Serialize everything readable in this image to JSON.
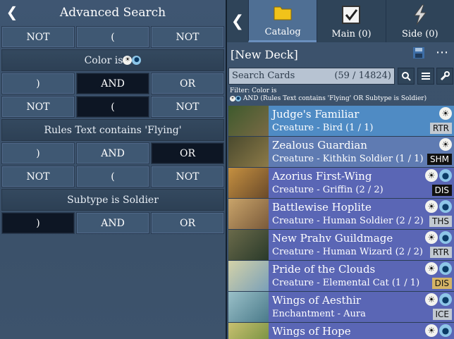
{
  "left": {
    "title": "Advanced Search",
    "rows": [
      {
        "cells": [
          {
            "label": "NOT",
            "sel": false
          },
          {
            "label": "(",
            "sel": false
          },
          {
            "label": "NOT",
            "sel": false
          }
        ]
      },
      {
        "label": "Color is",
        "mana": [
          "W",
          "U"
        ]
      },
      {
        "cells": [
          {
            "label": ")",
            "sel": false
          },
          {
            "label": "AND",
            "sel": true
          },
          {
            "label": "OR",
            "sel": false
          }
        ]
      },
      {
        "cells": [
          {
            "label": "NOT",
            "sel": false
          },
          {
            "label": "(",
            "sel": true
          },
          {
            "label": "NOT",
            "sel": false
          }
        ]
      },
      {
        "label": "Rules Text contains 'Flying'"
      },
      {
        "cells": [
          {
            "label": ")",
            "sel": false
          },
          {
            "label": "AND",
            "sel": false
          },
          {
            "label": "OR",
            "sel": true
          }
        ]
      },
      {
        "cells": [
          {
            "label": "NOT",
            "sel": false
          },
          {
            "label": "(",
            "sel": false
          },
          {
            "label": "NOT",
            "sel": false
          }
        ]
      },
      {
        "label": "Subtype is Soldier"
      },
      {
        "cells": [
          {
            "label": ")",
            "sel": true
          },
          {
            "label": "AND",
            "sel": false
          },
          {
            "label": "OR",
            "sel": false
          }
        ]
      }
    ]
  },
  "right": {
    "tabs": [
      {
        "label": "Catalog",
        "icon": "folder-icon",
        "active": true
      },
      {
        "label": "Main (0)",
        "icon": "checkbox-icon",
        "active": false
      },
      {
        "label": "Side (0)",
        "icon": "lightning-icon",
        "active": false
      }
    ],
    "deck_name": "[New Deck]",
    "search_placeholder": "Search Cards",
    "search_count": "(59 / 14824)",
    "filter_line1": "Filter: Color is",
    "filter_line2": "AND (Rules Text contains 'Flying' OR Subtype is Soldier)",
    "cards": [
      {
        "name": "Judge's Familiar",
        "type": "Creature - Bird (1 / 1)",
        "cost": [
          "W"
        ],
        "set": "RTR",
        "rarity": "uncommon",
        "bg": "#4f8bc4",
        "art": [
          "#3e5a2d",
          "#7a6a45"
        ]
      },
      {
        "name": "Zealous Guardian",
        "type": "Creature - Kithkin Soldier (1 / 1)",
        "cost": [
          "W"
        ],
        "set": "SHM",
        "rarity": "common",
        "bg": "#5f7bb2",
        "art": [
          "#4a4a2e",
          "#8c7a48"
        ]
      },
      {
        "name": "Azorius First-Wing",
        "type": "Creature - Griffin (2 / 2)",
        "cost": [
          "W",
          "U"
        ],
        "set": "DIS",
        "rarity": "common",
        "bg": "#5a66b5",
        "art": [
          "#c59040",
          "#6a4a2a"
        ]
      },
      {
        "name": "Battlewise Hoplite",
        "type": "Creature - Human Soldier (2 / 2)",
        "cost": [
          "W",
          "U"
        ],
        "set": "THS",
        "rarity": "uncommon",
        "bg": "#5a66b5",
        "art": [
          "#c9a46a",
          "#7a5a3a"
        ]
      },
      {
        "name": "New Prahv Guildmage",
        "type": "Creature - Human Wizard (2 / 2)",
        "cost": [
          "W",
          "U"
        ],
        "set": "RTR",
        "rarity": "uncommon",
        "bg": "#5a66b5",
        "art": [
          "#6a6a4a",
          "#2a3a2a"
        ]
      },
      {
        "name": "Pride of the Clouds",
        "type": "Creature - Elemental Cat (1 / 1)",
        "cost": [
          "W",
          "U"
        ],
        "set": "DIS",
        "rarity": "rare",
        "bg": "#5a66b5",
        "art": [
          "#d4d2a8",
          "#7aa0b8"
        ]
      },
      {
        "name": "Wings of Aesthir",
        "type": "Enchantment - Aura",
        "cost": [
          "W",
          "U"
        ],
        "set": "ICE",
        "rarity": "uncommon",
        "bg": "#5a66b5",
        "art": [
          "#9ac0c8",
          "#4a7a8a"
        ]
      },
      {
        "name": "Wings of Hope",
        "type": "",
        "cost": [
          "W",
          "U"
        ],
        "set": "",
        "rarity": "common",
        "bg": "#5a66b5",
        "art": [
          "#c8c070",
          "#6a8a3a"
        ]
      }
    ]
  }
}
